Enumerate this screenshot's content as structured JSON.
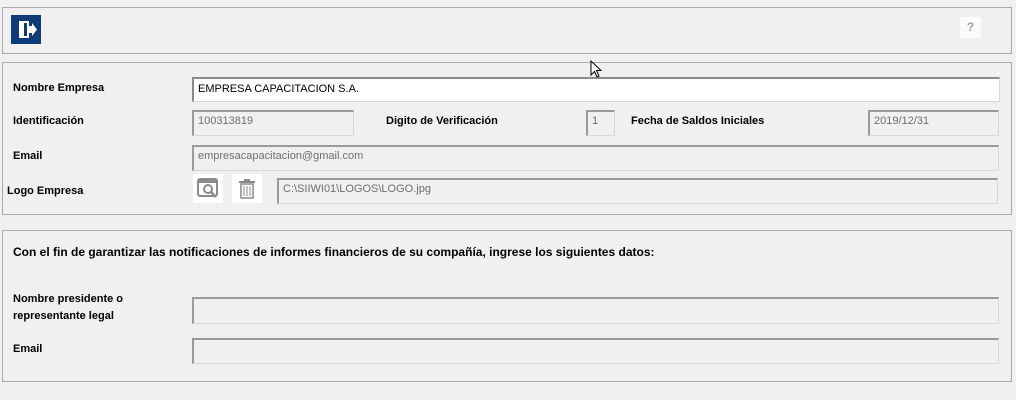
{
  "toolbar": {
    "exit_icon": "exit-icon",
    "help_label": "?"
  },
  "company": {
    "name_label": "Nombre Empresa",
    "name_value": "EMPRESA CAPACITACION S.A.",
    "id_label": "Identificación",
    "id_value": "100313819",
    "dv_label": "Digito de Verificación",
    "dv_value": "1",
    "fecha_label": "Fecha de Saldos Iniciales",
    "fecha_value": "2019/12/31",
    "email_label": "Email",
    "email_value": "empresacapacitacion@gmail.com",
    "logo_label": "Logo Empresa",
    "logo_path": "C:\\SIIWI01\\LOGOS\\LOGO.jpg"
  },
  "notifications": {
    "intro": "Con el fin de garantizar las notificaciones de informes financieros de su compañía, ingrese los siguientes datos:",
    "president_label_line1": "Nombre presidente o",
    "president_label_line2": "representante legal",
    "president_value": "",
    "email_label": "Email",
    "email_value": ""
  }
}
